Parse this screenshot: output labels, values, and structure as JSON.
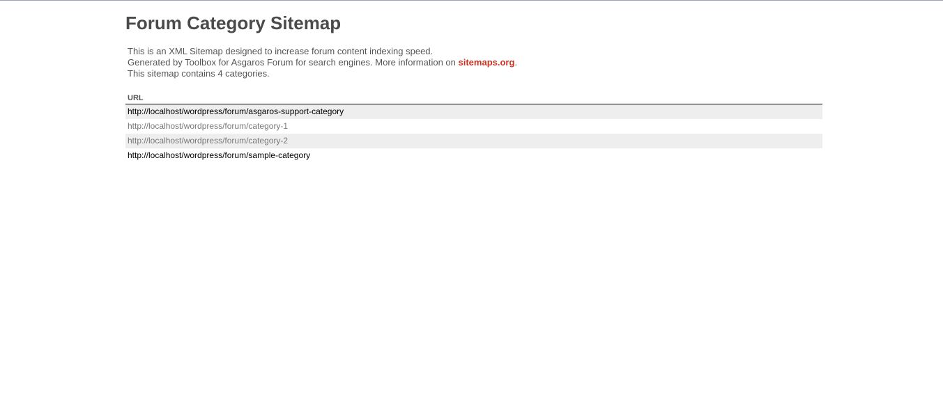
{
  "page": {
    "title": "Forum Category Sitemap",
    "intro_line1": "This is an XML Sitemap designed to increase forum content indexing speed.",
    "intro_line2_prefix": "Generated by Toolbox for Asgaros Forum for search engines. More information on ",
    "intro_link": "sitemaps.org",
    "intro_line2_suffix": ".",
    "intro_line3": "This sitemap contains 4 categories."
  },
  "table": {
    "header_url": "URL",
    "rows": [
      {
        "url": "http://localhost/wordpress/forum/asgaros-support-category"
      },
      {
        "url": "http://localhost/wordpress/forum/category-1"
      },
      {
        "url": "http://localhost/wordpress/forum/category-2"
      },
      {
        "url": "http://localhost/wordpress/forum/sample-category"
      }
    ]
  },
  "colors": {
    "link_accent": "#cc3322",
    "row_shade": "#eeeeee",
    "heading": "#4a4a4a"
  }
}
